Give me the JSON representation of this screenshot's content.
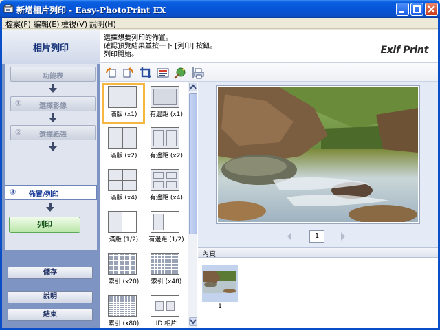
{
  "window": {
    "title": "新增相片列印 - Easy-PhotoPrint EX"
  },
  "menu": {
    "items": [
      "檔案(F)",
      "編輯(E)",
      "檢視(V)",
      "說明(H)"
    ]
  },
  "left_panel": {
    "header": "相片列印",
    "steps": [
      {
        "num": "",
        "label": "功能表"
      },
      {
        "num": "①",
        "label": "選擇影像"
      },
      {
        "num": "②",
        "label": "選擇紙張"
      }
    ],
    "active_step": {
      "num": "③",
      "label": "佈置/列印"
    },
    "print_label": "列印",
    "save_label": "儲存",
    "help_label": "說明",
    "exit_label": "結束"
  },
  "instructions": {
    "line1": "選擇想要列印的佈置。",
    "line2": "確認預覽結果並按一下 [列印] 按鈕。",
    "line3": "列印開始。",
    "logo": "Exif Print"
  },
  "toolbar": {
    "icons": [
      "rotate-left-icon",
      "rotate-right-icon",
      "crop-icon",
      "text-icon",
      "effects-icon",
      "print-settings-icon"
    ]
  },
  "layouts": [
    {
      "label": "滿版 (x1)",
      "selected": true
    },
    {
      "label": "有邊距 (x1)",
      "selected": false
    },
    {
      "label": "滿版 (x2)",
      "selected": false
    },
    {
      "label": "有邊距 (x2)",
      "selected": false
    },
    {
      "label": "滿版 (x4)",
      "selected": false
    },
    {
      "label": "有邊距 (x4)",
      "selected": false
    },
    {
      "label": "滿版 (1/2)",
      "selected": false
    },
    {
      "label": "有邊距 (1/2)",
      "selected": false
    },
    {
      "label": "索引 (x20)",
      "selected": false
    },
    {
      "label": "索引 (x48)",
      "selected": false
    },
    {
      "label": "索引 (x80)",
      "selected": false
    },
    {
      "label": "ID 相片",
      "selected": false
    }
  ],
  "preview": {
    "page_number": "1"
  },
  "pages": {
    "header": "內頁",
    "items": [
      {
        "number": "1"
      }
    ]
  }
}
